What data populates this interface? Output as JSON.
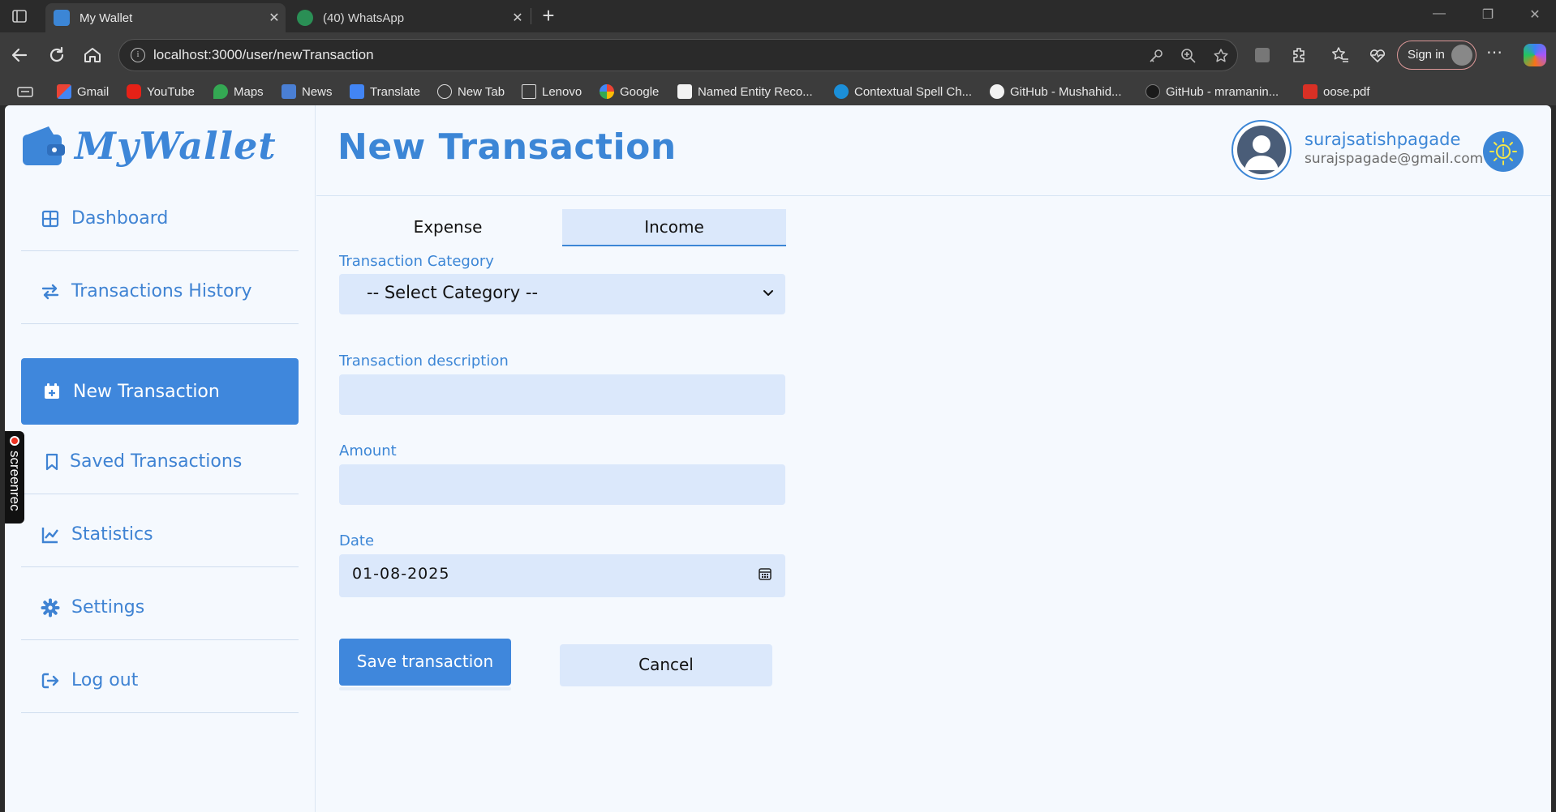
{
  "browser": {
    "tabs": [
      {
        "title": "My Wallet"
      },
      {
        "title": "(40) WhatsApp"
      }
    ],
    "url": "localhost:3000/user/newTransaction",
    "signin_label": "Sign in",
    "bookmarks": [
      {
        "label": "Gmail"
      },
      {
        "label": "YouTube"
      },
      {
        "label": "Maps"
      },
      {
        "label": "News"
      },
      {
        "label": "Translate"
      },
      {
        "label": "New Tab"
      },
      {
        "label": "Lenovo"
      },
      {
        "label": "Google"
      },
      {
        "label": "Named Entity Reco..."
      },
      {
        "label": "Contextual Spell Ch..."
      },
      {
        "label": "GitHub - Mushahid..."
      },
      {
        "label": "GitHub - mramanin..."
      },
      {
        "label": "oose.pdf"
      }
    ]
  },
  "screenrec": {
    "label": "screenrec"
  },
  "app": {
    "logo_text": "MyWallet",
    "sidebar": {
      "items": [
        {
          "label": "Dashboard",
          "icon": "grid-icon"
        },
        {
          "label": "Transactions History",
          "icon": "swap-arrows-icon"
        },
        {
          "label": "New Transaction",
          "icon": "calendar-plus-icon",
          "active": true
        },
        {
          "label": "Saved Transactions",
          "icon": "bookmark-icon"
        },
        {
          "label": "Statistics",
          "icon": "chart-line-icon"
        },
        {
          "label": "Settings",
          "icon": "gear-icon"
        },
        {
          "label": "Log out",
          "icon": "logout-icon"
        }
      ]
    },
    "header": {
      "title": "New Transaction",
      "username": "surajsatishpagade",
      "email": "surajspagade@gmail.com"
    },
    "form": {
      "tabs": [
        {
          "label": "Expense"
        },
        {
          "label": "Income",
          "active": true
        }
      ],
      "category_label": "Transaction Category",
      "category_value": "-- Select Category --",
      "description_label": "Transaction description",
      "description_value": "",
      "amount_label": "Amount",
      "amount_value": "",
      "date_label": "Date",
      "date_value": "01-08-2025",
      "save_label": "Save transaction",
      "cancel_label": "Cancel"
    }
  },
  "colors": {
    "accent": "#3f87dc",
    "input_bg": "#dbe8fb",
    "page_bg": "#f5f9fe"
  }
}
